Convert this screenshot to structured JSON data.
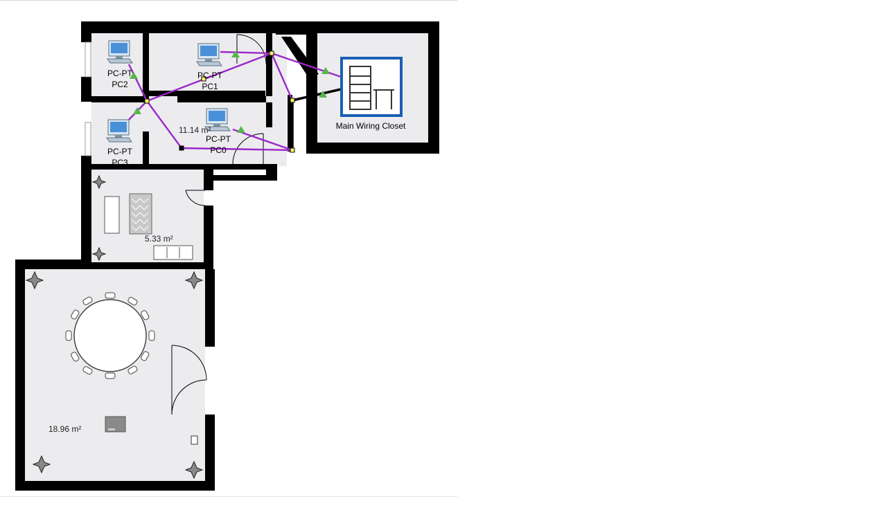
{
  "devices": {
    "pc0": {
      "type": "PC-PT",
      "name": "PC0"
    },
    "pc1": {
      "type": "PC-PT",
      "name": "PC1"
    },
    "pc2": {
      "type": "PC-PT",
      "name": "PC2"
    },
    "pc3": {
      "type": "PC-PT",
      "name": "PC3"
    },
    "closet": {
      "name": "Main Wiring Closet"
    }
  },
  "rooms": {
    "office_area": "11.14 m²",
    "lounge_area": "5.33 m²",
    "conference_area": "18.96 m²"
  },
  "colors": {
    "wall": "#000000",
    "floor": "#ececef",
    "cable": "#9b27c9",
    "link_up": "#4caf50",
    "closet_frame": "#1a5fb4"
  }
}
